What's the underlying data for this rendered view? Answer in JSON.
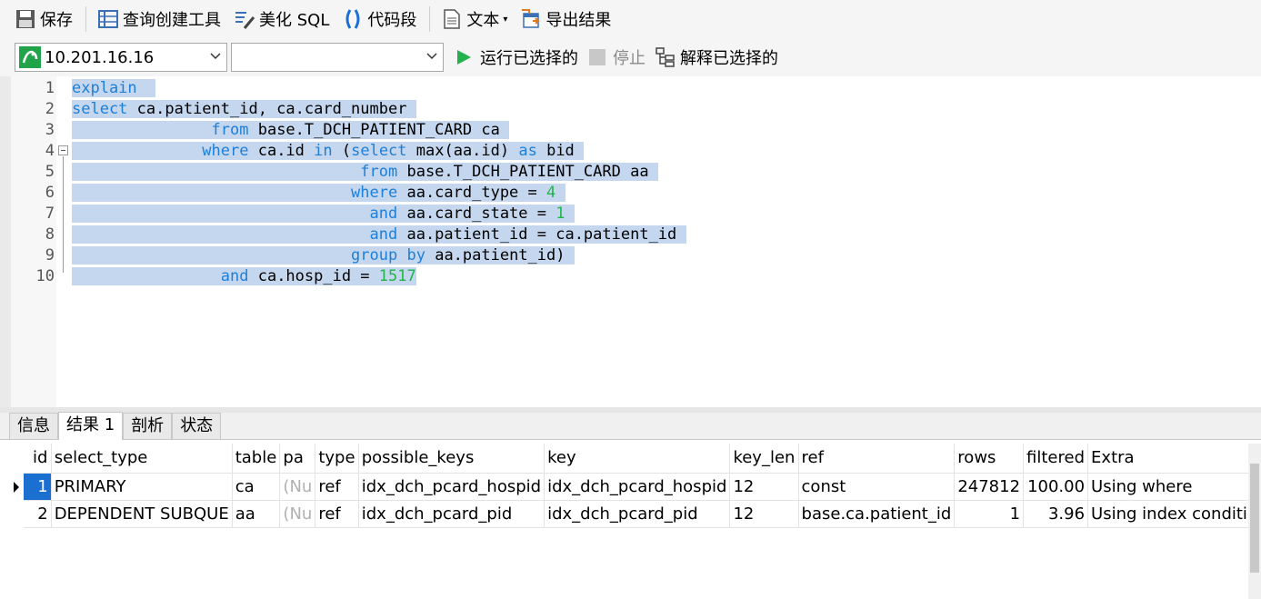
{
  "toolbar": {
    "save": "保存",
    "query_builder": "查询创建工具",
    "beautify": "美化 SQL",
    "snippet": "代码段",
    "text": "文本",
    "export": "导出结果"
  },
  "connbar": {
    "connection": "10.201.16.16",
    "database": "",
    "run_selected": "运行已选择的",
    "stop": "停止",
    "explain_selected": "解释已选择的"
  },
  "editor": {
    "line_numbers": [
      "1",
      "2",
      "3",
      "4",
      "5",
      "6",
      "7",
      "8",
      "9",
      "10"
    ]
  },
  "tabs": [
    "信息",
    "结果 1",
    "剖析",
    "状态"
  ],
  "grid": {
    "columns": [
      "id",
      "select_type",
      "table",
      "pa",
      "type",
      "possible_keys",
      "key",
      "key_len",
      "ref",
      "rows",
      "filtered",
      "Extra"
    ],
    "rows": [
      [
        "1",
        "PRIMARY",
        "ca",
        "(Nu",
        "ref",
        "idx_dch_pcard_hospid",
        "idx_dch_pcard_hospid",
        "12",
        "const",
        "247812",
        "100.00",
        "Using where"
      ],
      [
        "2",
        "DEPENDENT SUBQUE",
        "aa",
        "(Nu",
        "ref",
        "idx_dch_pcard_pid",
        "idx_dch_pcard_pid",
        "12",
        "base.ca.patient_id",
        "1",
        "3.96",
        "Using index conditio"
      ]
    ]
  },
  "colors": {
    "keyword": "#1d7fd8",
    "number": "#21b54a",
    "selection": "#c4d7ef",
    "selected_cell": "#1a6fd0"
  }
}
